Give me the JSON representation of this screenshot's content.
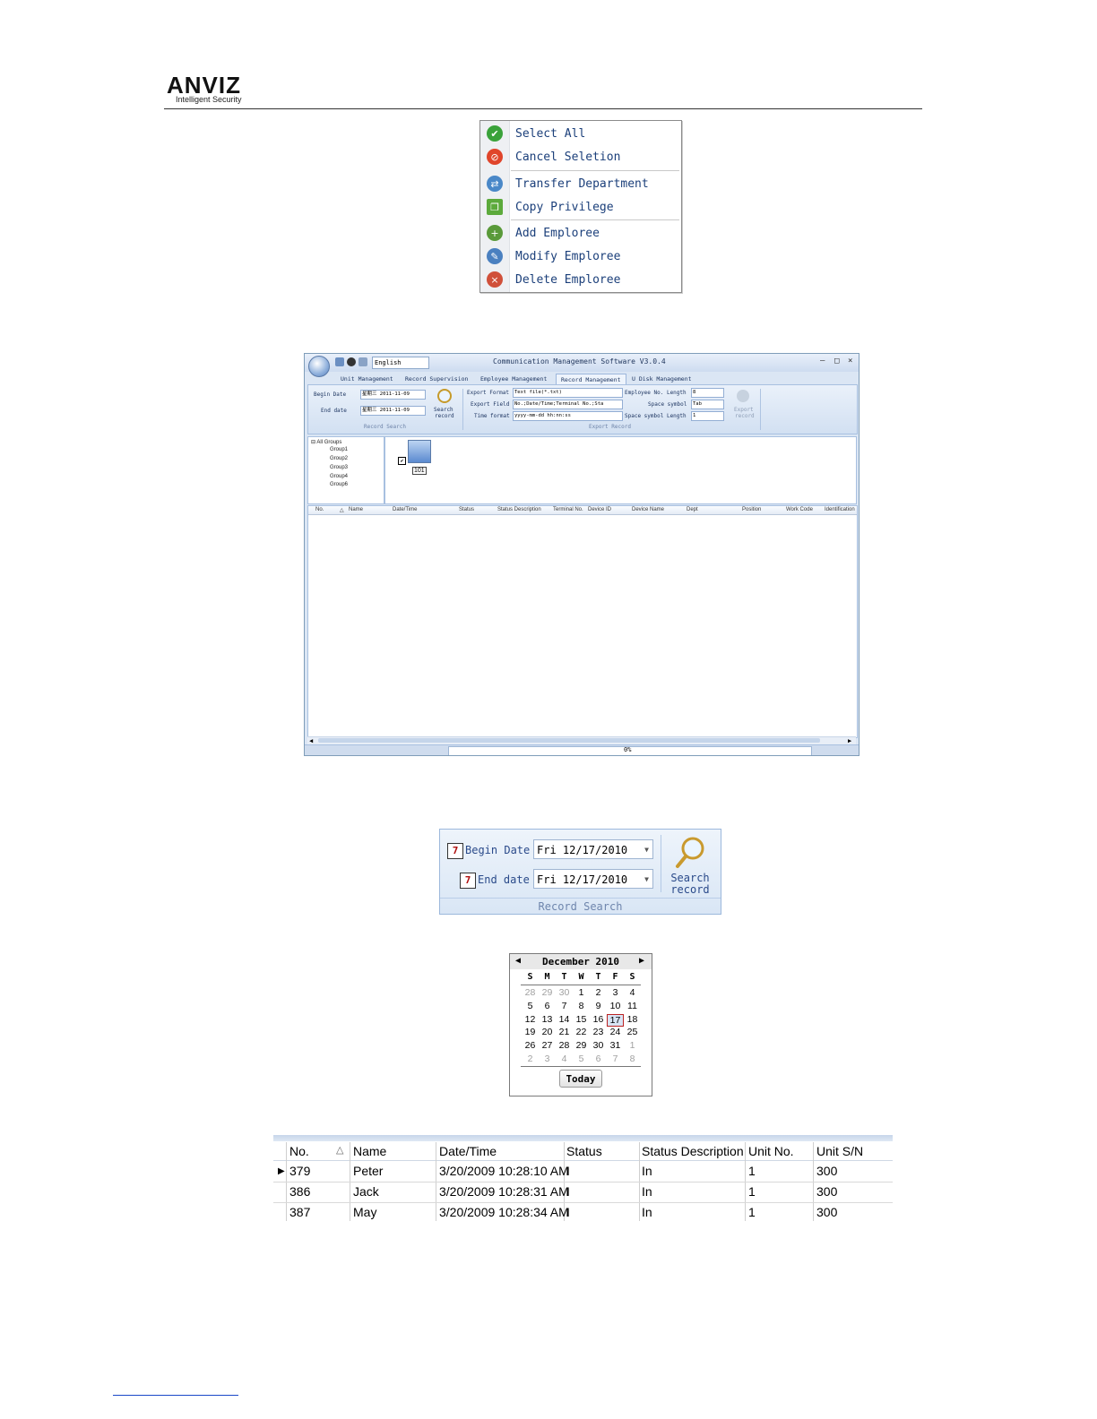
{
  "header": {
    "logo_text": "ANVIZ",
    "logo_tagline": "Intelligent Security"
  },
  "context_menu": {
    "items": [
      {
        "label": "Select All",
        "icon": "check-icon",
        "color": "#3aa23a"
      },
      {
        "label": "Cancel Seletion",
        "icon": "cancel-icon",
        "color": "#e0452b"
      },
      {
        "label": "Transfer Department",
        "icon": "transfer-icon",
        "color": "#4a88c8"
      },
      {
        "label": "Copy Privilege",
        "icon": "copy-icon",
        "color": "#5caa3c"
      },
      {
        "label": "Add Emploree",
        "icon": "add-user-icon",
        "color": "#5a9a3a"
      },
      {
        "label": "Modify Emploree",
        "icon": "modify-user-icon",
        "color": "#4a80c0"
      },
      {
        "label": "Delete Emploree",
        "icon": "delete-user-icon",
        "color": "#d0503a"
      }
    ]
  },
  "app": {
    "language": "English",
    "title": "Communication Management Software V3.0.4",
    "tabs": [
      "Unit Management",
      "Record Supervision",
      "Employee Management",
      "Record Management",
      "U Disk Management"
    ],
    "active_tab": "Record Management",
    "record_search": {
      "begin_label": "Begin Date",
      "begin_value": "星期三 2011-11-09",
      "end_label": "End date",
      "end_value": "星期三 2011-11-09",
      "search_label_1": "Search",
      "search_label_2": "record",
      "group_label": "Record Search"
    },
    "export": {
      "format_label": "Export Format",
      "format_value": "Text file(*.txt)",
      "field_label": "Export Field",
      "field_value": "No.;Date/Time;Terminal No.;Sta",
      "time_label": "Time format",
      "time_value": "yyyy-mm-dd hh:nn:ss",
      "emp_len_label": "Employee No. Length",
      "emp_len_value": "8",
      "space_label": "Space symbol",
      "space_value": "Tab",
      "space_len_label": "Space symbol Length",
      "space_len_value": "1",
      "export_btn_1": "Export",
      "export_btn_2": "record",
      "group_label": "Export Record"
    },
    "tree": [
      "All Groups",
      "Group1",
      "Group2",
      "Group3",
      "Group4",
      "Group6"
    ],
    "device_label": "101",
    "grid_headers": [
      "No.",
      "Name",
      "Date/Time",
      "Status",
      "Status Description",
      "Terminal No.",
      "Device ID",
      "Device Name",
      "Dept",
      "Position",
      "Work Code",
      "Identification"
    ],
    "progress_text": "0%"
  },
  "record_search_panel": {
    "begin_label": "Begin Date",
    "begin_value": "Fri  12/17/2010",
    "end_label": "End date",
    "end_value": "Fri  12/17/2010",
    "search_1": "Search",
    "search_2": "record",
    "group_label": "Record Search"
  },
  "calendar": {
    "title": "December 2010",
    "dow": [
      "S",
      "M",
      "T",
      "W",
      "T",
      "F",
      "S"
    ],
    "weeks": [
      [
        "28",
        "29",
        "30",
        "1",
        "2",
        "3",
        "4"
      ],
      [
        "5",
        "6",
        "7",
        "8",
        "9",
        "10",
        "11"
      ],
      [
        "12",
        "13",
        "14",
        "15",
        "16",
        "17",
        "18"
      ],
      [
        "19",
        "20",
        "21",
        "22",
        "23",
        "24",
        "25"
      ],
      [
        "26",
        "27",
        "28",
        "29",
        "30",
        "31",
        "1"
      ],
      [
        "2",
        "3",
        "4",
        "5",
        "6",
        "7",
        "8"
      ]
    ],
    "dim": [
      [
        0,
        0
      ],
      [
        0,
        1
      ],
      [
        0,
        2
      ],
      [
        4,
        6
      ],
      [
        5,
        0
      ],
      [
        5,
        1
      ],
      [
        5,
        2
      ],
      [
        5,
        3
      ],
      [
        5,
        4
      ],
      [
        5,
        5
      ],
      [
        5,
        6
      ]
    ],
    "selected": [
      2,
      5
    ],
    "today_label": "Today"
  },
  "records_table": {
    "headers": [
      "No.",
      "Name",
      "Date/Time",
      "Status",
      "Status Description",
      "Unit No.",
      "Unit S/N"
    ],
    "rows": [
      [
        "379",
        "Peter",
        "3/20/2009 10:28:10 AM",
        "I",
        "In",
        "1",
        "300"
      ],
      [
        "386",
        "Jack",
        "3/20/2009 10:28:31 AM",
        "I",
        "In",
        "1",
        "300"
      ],
      [
        "387",
        "May",
        "3/20/2009 10:28:34 AM",
        "I",
        "In",
        "1",
        "300"
      ]
    ]
  }
}
